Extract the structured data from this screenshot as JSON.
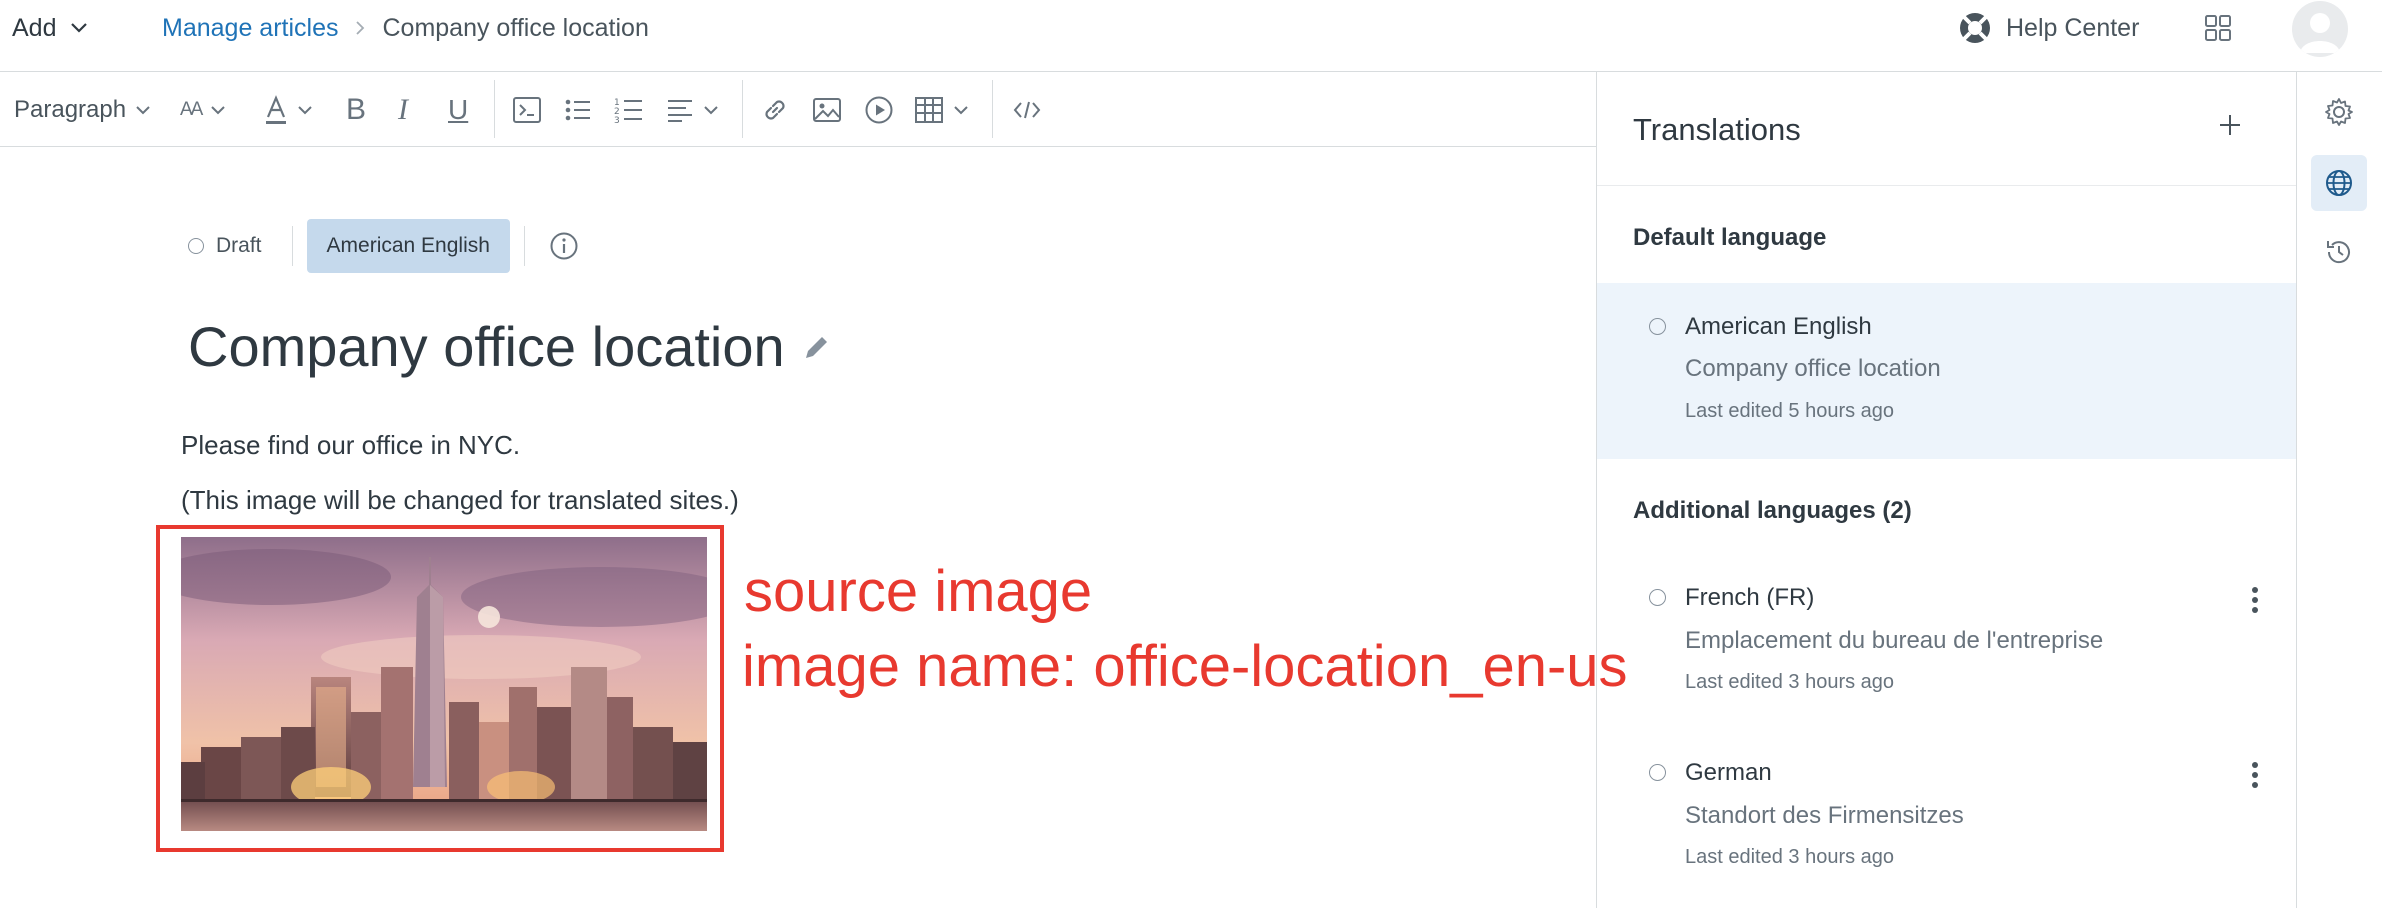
{
  "header": {
    "add_label": "Add",
    "breadcrumb_link": "Manage articles",
    "breadcrumb_current": "Company office location",
    "help_label": "Help Center"
  },
  "toolbar": {
    "paragraph_label": "Paragraph",
    "font_size_label": "AA",
    "bold_label": "B",
    "italic_label": "I",
    "underline_label": "U"
  },
  "editor": {
    "status_label": "Draft",
    "language_label": "American English",
    "title": "Company office location",
    "paragraph1": "Please find our office in NYC.",
    "paragraph2": "(This image will be changed for translated sites.)"
  },
  "annotation": {
    "line1": "source image",
    "line2": "image name: office-location_en-us",
    "color": "#e8392f"
  },
  "translations": {
    "title": "Translations",
    "default_heading": "Default language",
    "default": {
      "language": "American English",
      "title": "Company office location",
      "edited": "Last edited 5 hours ago"
    },
    "additional_heading": "Additional languages (2)",
    "additional": [
      {
        "language": "French (FR)",
        "title": "Emplacement du bureau de l'entreprise",
        "edited": "Last edited 3 hours ago"
      },
      {
        "language": "German",
        "title": "Standort des Firmensitzes",
        "edited": "Last edited 3 hours ago"
      }
    ]
  },
  "colors": {
    "link": "#1f73b7",
    "pill": "#c5d9ec",
    "active_row": "#edf4fb",
    "annotation": "#e8392f"
  },
  "icons": {
    "add": "chevron-down-icon",
    "help": "lifebuoy-icon",
    "apps": "grid-icon",
    "avatar": "user-avatar",
    "rail": [
      "gear-icon",
      "globe-icon",
      "history-icon"
    ]
  }
}
